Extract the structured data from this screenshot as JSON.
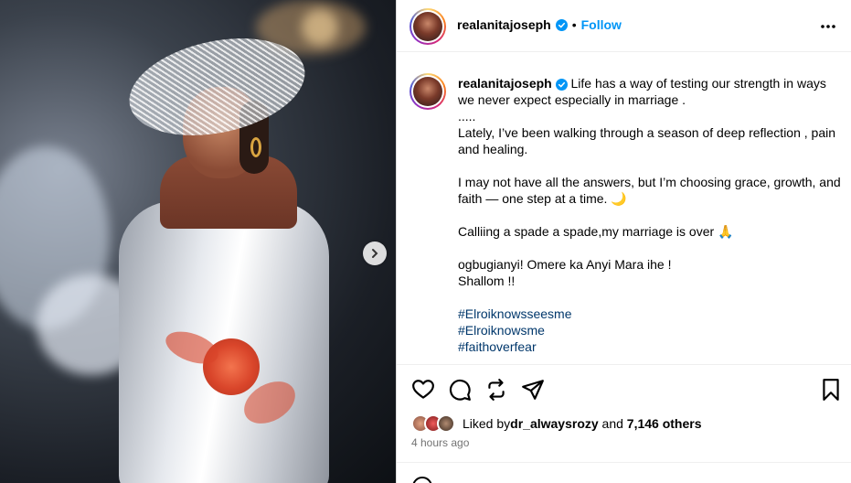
{
  "post": {
    "author": "realanitajoseph",
    "separator": "•",
    "follow_label": "Follow",
    "more_icon": "more-horizontal-icon"
  },
  "caption": {
    "author": "realanitajoseph",
    "line1": "Life has a way of testing our strength in ways we never expect especially in marriage .",
    "line2": ".....",
    "line3": "Lately, I’ve been walking through a season of deep reflection , pain and healing.",
    "line4": "I may not have all the answers, but I’m choosing grace, growth, and faith — one step at a time. 🌙",
    "line5": "Calliing a spade a spade,my marriage is over 🙏",
    "line6": "ogbugianyi! Omere ka Anyi Mara ihe !",
    "line7": "Shallom !!",
    "hashtags": [
      "#Elroiknowsseesme",
      "#Elroiknowsme",
      "#faithoverfear"
    ]
  },
  "engagement": {
    "liked_by_prefix": "Liked by ",
    "liked_by_user": "dr_alwaysrozy",
    "and_text": " and ",
    "others": "7,146 others",
    "time": "4 hours ago"
  },
  "colors": {
    "accent": "#0095f6",
    "hashtag": "#00376b",
    "muted": "#737373"
  }
}
